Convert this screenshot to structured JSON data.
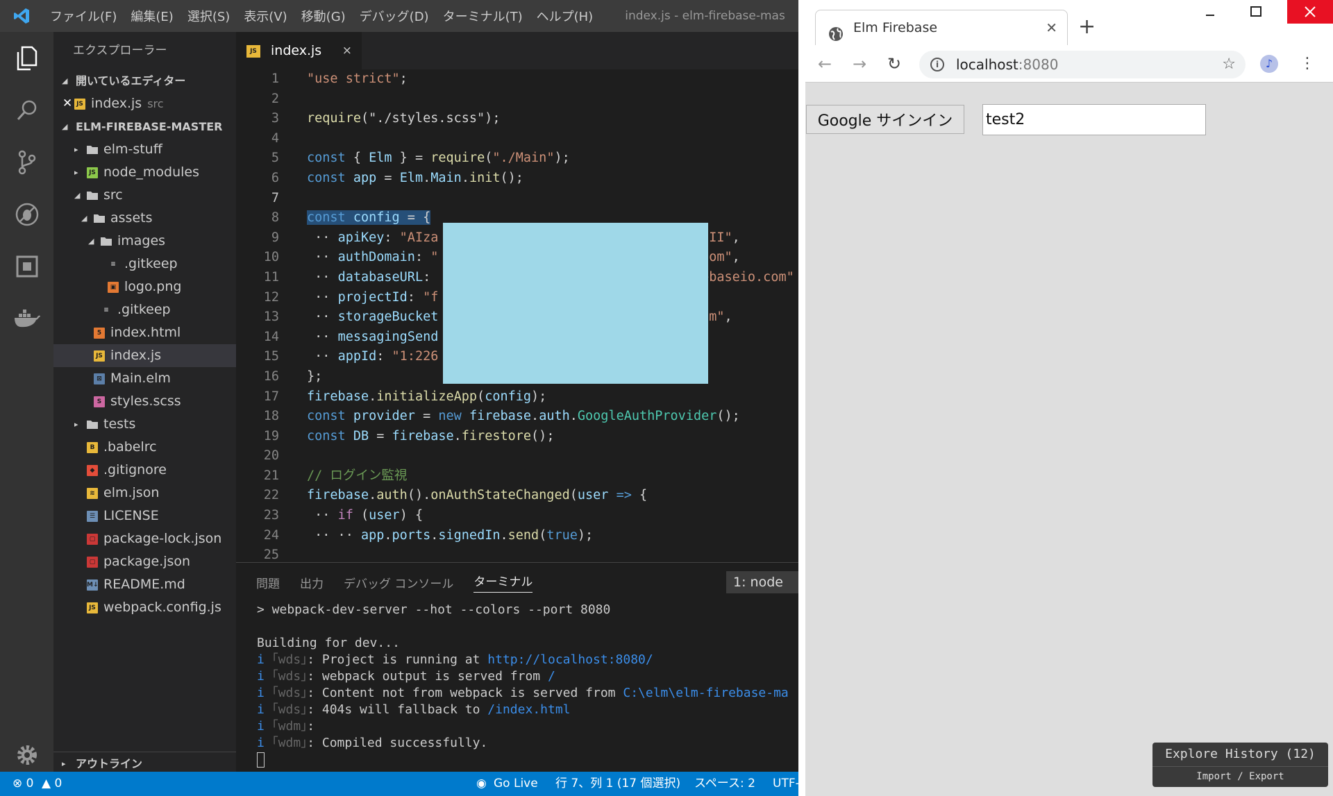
{
  "vscode": {
    "menus": [
      "ファイル(F)",
      "編集(E)",
      "選択(S)",
      "表示(V)",
      "移動(G)",
      "デバッグ(D)",
      "ターミナル(T)",
      "ヘルプ(H)"
    ],
    "window_title": "index.js - elm-firebase-mas",
    "sidebar": {
      "title": "エクスプローラー",
      "open_editors_label": "開いているエディター",
      "open_editor_file": "index.js",
      "open_editor_dir": "src",
      "project_label": "ELM-FIREBASE-MASTER",
      "tree": [
        {
          "label": "elm-stuff",
          "type": "folder",
          "depth": 0,
          "twisty": "▸",
          "icon_color": "#c5c5c5"
        },
        {
          "label": "node_modules",
          "type": "node",
          "depth": 0,
          "twisty": "▸",
          "icon_color": "#8cc84b"
        },
        {
          "label": "src",
          "type": "folder",
          "depth": 0,
          "twisty": "◢",
          "icon_color": "#c5c5c5"
        },
        {
          "label": "assets",
          "type": "folder",
          "depth": 1,
          "twisty": "◢",
          "icon_color": "#c5c5c5"
        },
        {
          "label": "images",
          "type": "folder",
          "depth": 2,
          "twisty": "◢",
          "icon_color": "#c5c5c5"
        },
        {
          "label": ".gitkeep",
          "type": "doc",
          "depth": 3,
          "twisty": "",
          "icon_color": "#c5c5c5"
        },
        {
          "label": "logo.png",
          "type": "image",
          "depth": 3,
          "twisty": "",
          "icon_color": "#e37933"
        },
        {
          "label": ".gitkeep",
          "type": "doc",
          "depth": 2,
          "twisty": "",
          "icon_color": "#c5c5c5"
        },
        {
          "label": "index.html",
          "type": "html",
          "depth": 1,
          "twisty": "",
          "icon_color": "#e37933"
        },
        {
          "label": "index.js",
          "type": "js",
          "depth": 1,
          "twisty": "",
          "icon_color": "#e8b83a",
          "selected": true
        },
        {
          "label": "Main.elm",
          "type": "elm",
          "depth": 1,
          "twisty": "",
          "icon_color": "#5c7fa8"
        },
        {
          "label": "styles.scss",
          "type": "scss",
          "depth": 1,
          "twisty": "",
          "icon_color": "#cd67a1"
        },
        {
          "label": "tests",
          "type": "folder",
          "depth": 0,
          "twisty": "▸",
          "icon_color": "#c5c5c5"
        },
        {
          "label": ".babelrc",
          "type": "babel",
          "depth": 0,
          "twisty": "",
          "icon_color": "#e8b83a"
        },
        {
          "label": ".gitignore",
          "type": "git",
          "depth": 0,
          "twisty": "",
          "icon_color": "#e44d3a"
        },
        {
          "label": "elm.json",
          "type": "db",
          "depth": 0,
          "twisty": "",
          "icon_color": "#e8b83a"
        },
        {
          "label": "LICENSE",
          "type": "license",
          "depth": 0,
          "twisty": "",
          "icon_color": "#6d8fb5"
        },
        {
          "label": "package-lock.json",
          "type": "npm",
          "depth": 0,
          "twisty": "",
          "icon_color": "#cb3837"
        },
        {
          "label": "package.json",
          "type": "npm",
          "depth": 0,
          "twisty": "",
          "icon_color": "#cb3837"
        },
        {
          "label": "README.md",
          "type": "md",
          "depth": 0,
          "twisty": "",
          "icon_color": "#6d8fb5"
        },
        {
          "label": "webpack.config.js",
          "type": "js",
          "depth": 0,
          "twisty": "",
          "icon_color": "#e8b83a"
        }
      ],
      "outline_label": "アウトライン"
    },
    "tab": {
      "label": "index.js",
      "badge": "JS",
      "close": "×"
    },
    "code_lines": [
      [
        [
          "s",
          "\"use strict\""
        ],
        [
          "",
          ";"
        ]
      ],
      [],
      [
        [
          "f",
          "require"
        ],
        [
          "",
          "(\"./styles.scss\");"
        ]
      ],
      [],
      [
        [
          "k",
          "const"
        ],
        [
          "",
          " { "
        ],
        [
          "v",
          "Elm"
        ],
        [
          "",
          " } = "
        ],
        [
          "f",
          "require"
        ],
        [
          "",
          "("
        ],
        [
          "s",
          "\"./Main\""
        ],
        [
          "",
          ");"
        ]
      ],
      [
        [
          "k",
          "const"
        ],
        [
          "",
          " "
        ],
        [
          "v",
          "app"
        ],
        [
          "",
          " = "
        ],
        [
          "v",
          "Elm"
        ],
        [
          "",
          "."
        ],
        [
          "v",
          "Main"
        ],
        [
          "",
          "."
        ],
        [
          "f",
          "init"
        ],
        [
          "",
          "();"
        ]
      ],
      [],
      [
        [
          "k",
          "const"
        ],
        [
          "",
          " "
        ],
        [
          "v",
          "config"
        ],
        [
          "",
          " = {"
        ]
      ],
      [
        [
          "",
          " ·· "
        ],
        [
          "v",
          "apiKey"
        ],
        [
          "",
          ": "
        ],
        [
          "s",
          "\"AIza"
        ],
        [
          "",
          "                                   "
        ],
        [
          "s",
          "II\""
        ],
        [
          "",
          ","
        ]
      ],
      [
        [
          "",
          " ·· "
        ],
        [
          "v",
          "authDomain"
        ],
        [
          "",
          ": "
        ],
        [
          "s",
          "\""
        ],
        [
          "",
          "                                  "
        ],
        [
          "s",
          "com\""
        ],
        [
          "",
          ","
        ]
      ],
      [
        [
          "",
          " ·· "
        ],
        [
          "v",
          "databaseURL"
        ],
        [
          "",
          ": "
        ],
        [
          "",
          "                                  "
        ],
        [
          "s",
          "ebaseio.com\""
        ]
      ],
      [
        [
          "",
          " ·· "
        ],
        [
          "v",
          "projectId"
        ],
        [
          "",
          ": "
        ],
        [
          "s",
          "\"f"
        ]
      ],
      [
        [
          "",
          " ·· "
        ],
        [
          "v",
          "storageBucket"
        ],
        [
          "",
          "                                  "
        ],
        [
          "s",
          "om\""
        ],
        [
          "",
          ","
        ]
      ],
      [
        [
          "",
          " ·· "
        ],
        [
          "v",
          "messagingSend"
        ]
      ],
      [
        [
          "",
          " ·· "
        ],
        [
          "v",
          "appId"
        ],
        [
          "",
          ": "
        ],
        [
          "s",
          "\"1:226"
        ]
      ],
      [
        [
          "",
          "};"
        ]
      ],
      [
        [
          "v",
          "firebase"
        ],
        [
          "",
          "."
        ],
        [
          "f",
          "initializeApp"
        ],
        [
          "",
          "("
        ],
        [
          "v",
          "config"
        ],
        [
          "",
          ");"
        ]
      ],
      [
        [
          "k",
          "const"
        ],
        [
          "",
          " "
        ],
        [
          "v",
          "provider"
        ],
        [
          "",
          " = "
        ],
        [
          "k",
          "new"
        ],
        [
          "",
          " "
        ],
        [
          "v",
          "firebase"
        ],
        [
          "",
          "."
        ],
        [
          "v",
          "auth"
        ],
        [
          "",
          "."
        ],
        [
          "t",
          "GoogleAuthProvider"
        ],
        [
          "",
          "();"
        ]
      ],
      [
        [
          "k",
          "const"
        ],
        [
          "",
          " "
        ],
        [
          "v",
          "DB"
        ],
        [
          "",
          " = "
        ],
        [
          "v",
          "firebase"
        ],
        [
          "",
          "."
        ],
        [
          "f",
          "firestore"
        ],
        [
          "",
          "();"
        ]
      ],
      [],
      [
        [
          "c",
          "// ログイン監視"
        ]
      ],
      [
        [
          "v",
          "firebase"
        ],
        [
          "",
          "."
        ],
        [
          "f",
          "auth"
        ],
        [
          "",
          "()."
        ],
        [
          "f",
          "onAuthStateChanged"
        ],
        [
          "",
          "("
        ],
        [
          "v",
          "user"
        ],
        [
          "",
          " "
        ],
        [
          "k",
          "=>"
        ],
        [
          "",
          " {"
        ]
      ],
      [
        [
          "",
          " ·· "
        ],
        [
          "p",
          "if"
        ],
        [
          "",
          " ("
        ],
        [
          "v",
          "user"
        ],
        [
          "",
          ") {"
        ]
      ],
      [
        [
          "",
          " ·· ·· "
        ],
        [
          "v",
          "app"
        ],
        [
          "",
          "."
        ],
        [
          "v",
          "ports"
        ],
        [
          "",
          "."
        ],
        [
          "v",
          "signedIn"
        ],
        [
          "",
          "."
        ],
        [
          "f",
          "send"
        ],
        [
          "",
          "("
        ],
        [
          "k",
          "true"
        ],
        [
          "",
          ");"
        ]
      ],
      []
    ],
    "current_line": 7,
    "panel": {
      "tabs": [
        "問題",
        "出力",
        "デバッグ コンソール",
        "ターミナル"
      ],
      "terminal_select": "1: node",
      "terminal_lines": [
        [
          [
            "",
            "> webpack-dev-server --hot --colors --port 8080"
          ]
        ],
        [],
        [
          [
            "",
            "Building for dev..."
          ]
        ],
        [
          [
            "bi",
            "i"
          ],
          [
            "",
            " "
          ],
          [
            "gr",
            "｢wds｣"
          ],
          [
            "",
            ": Project is running at "
          ],
          [
            "ul",
            "http://localhost:8080/"
          ]
        ],
        [
          [
            "bi",
            "i"
          ],
          [
            "",
            " "
          ],
          [
            "gr",
            "｢wds｣"
          ],
          [
            "",
            ": webpack output is served from "
          ],
          [
            "ul",
            "/"
          ]
        ],
        [
          [
            "bi",
            "i"
          ],
          [
            "",
            " "
          ],
          [
            "gr",
            "｢wds｣"
          ],
          [
            "",
            ": Content not from webpack is served from "
          ],
          [
            "ul",
            "C:\\elm\\elm-firebase-ma"
          ]
        ],
        [
          [
            "bi",
            "i"
          ],
          [
            "",
            " "
          ],
          [
            "gr",
            "｢wds｣"
          ],
          [
            "",
            ": 404s will fallback to "
          ],
          [
            "ul",
            "/index.html"
          ]
        ],
        [
          [
            "bi",
            "i"
          ],
          [
            "",
            " "
          ],
          [
            "gr",
            "｢wdm｣"
          ],
          [
            "",
            ":"
          ]
        ],
        [
          [
            "bi",
            "i"
          ],
          [
            "",
            " "
          ],
          [
            "gr",
            "｢wdm｣"
          ],
          [
            "",
            ": Compiled successfully."
          ]
        ]
      ]
    },
    "status": {
      "errors": "⊗ 0",
      "warnings": "▲ 0",
      "golive": "Go Live",
      "position": "行 7、列 1 (17 個選択)",
      "spaces": "スペース: 2",
      "encoding": "UTF-"
    }
  },
  "browser": {
    "tab_title": "Elm Firebase",
    "url_host": "localhost",
    "url_port": ":8080",
    "page": {
      "signin_button": "Google サインイン",
      "input_value": "test2"
    },
    "history_button": "Explore History (12)",
    "history_sub": "Import / Export"
  }
}
